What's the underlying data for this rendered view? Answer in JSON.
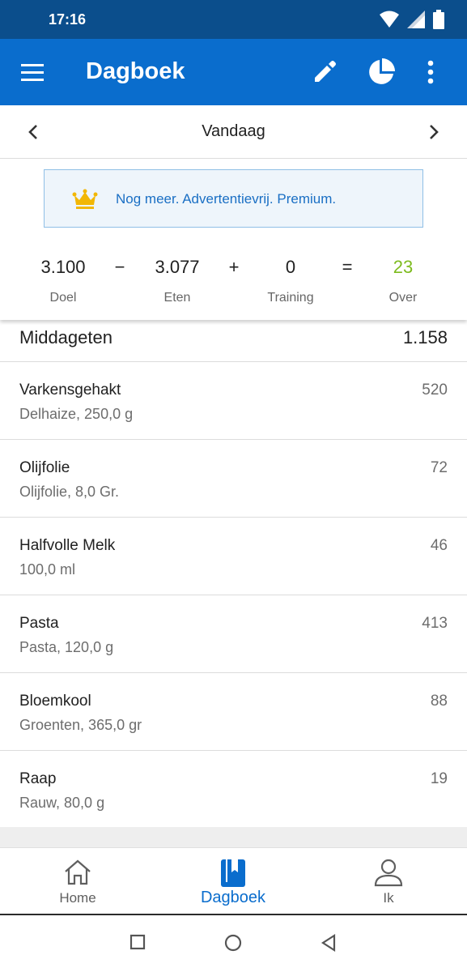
{
  "status_bar": {
    "time": "17:16"
  },
  "app_bar": {
    "title": "Dagboek"
  },
  "date_nav": {
    "label": "Vandaag"
  },
  "premium": {
    "text": "Nog meer. Advertentievrij. Premium."
  },
  "calc": {
    "goal_value": "3.100",
    "goal_label": "Doel",
    "minus": "−",
    "food_value": "3.077",
    "food_label": "Eten",
    "plus": "+",
    "exercise_value": "0",
    "exercise_label": "Training",
    "equals": "=",
    "remaining_value": "23",
    "remaining_label": "Over"
  },
  "colors": {
    "app_bar": "#0a6dcd",
    "status_bar": "#0b4e8c",
    "remaining": "#7dbb1e",
    "crown": "#f2b705"
  },
  "section": {
    "title": "Middageten",
    "total": "1.158"
  },
  "foods": [
    {
      "name": "Varkensgehakt",
      "detail": "Delhaize, 250,0 g",
      "kcal": "520"
    },
    {
      "name": "Olijfolie",
      "detail": "Olijfolie, 8,0 Gr.",
      "kcal": "72"
    },
    {
      "name": "Halfvolle Melk",
      "detail": "100,0 ml",
      "kcal": "46"
    },
    {
      "name": "Pasta",
      "detail": "Pasta, 120,0 g",
      "kcal": "413"
    },
    {
      "name": "Bloemkool",
      "detail": "Groenten, 365,0 gr",
      "kcal": "88"
    },
    {
      "name": "Raap",
      "detail": "Rauw, 80,0 g",
      "kcal": "19"
    }
  ],
  "bottom_nav": {
    "home": "Home",
    "diary": "Dagboek",
    "me": "Ik"
  },
  "icons": [
    "wifi-icon",
    "signal-icon",
    "battery-icon",
    "menu-icon",
    "edit-icon",
    "pie-chart-icon",
    "more-vert-icon",
    "chevron-left-icon",
    "chevron-right-icon",
    "crown-icon",
    "home-icon",
    "diary-icon",
    "person-icon",
    "recents-icon",
    "home-circle-icon",
    "back-icon"
  ]
}
